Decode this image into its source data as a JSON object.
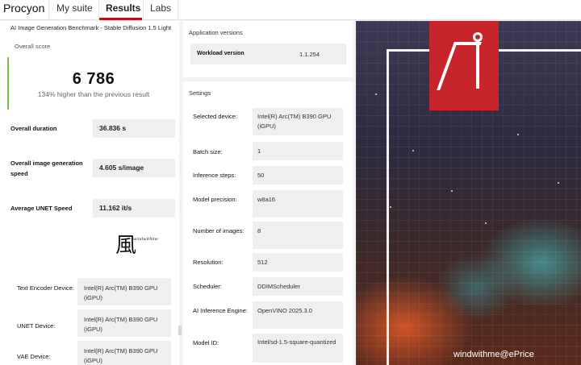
{
  "nav": {
    "brand": "Procyon",
    "tabs": [
      {
        "label": "My suite"
      },
      {
        "label": "Results"
      },
      {
        "label": "Labs"
      }
    ]
  },
  "benchmark": {
    "title": "AI Image Generation Benchmark - Stable Diffusion 1.5 Light",
    "overall_score_label": "Overall score",
    "overall_score": "6 786",
    "comparison": "134% higher than the previous result",
    "score_accent_color": "#7dc23f"
  },
  "metrics": [
    {
      "label": "Overall duration",
      "value": "36.836 s"
    },
    {
      "label": "Overall image generation speed",
      "value": "4.605 s/image"
    },
    {
      "label": "Average UNET Speed",
      "value": "11.162 it/s"
    }
  ],
  "logo": {
    "glyph": "風",
    "text": "windwithme"
  },
  "devices": [
    {
      "label": "Text Encoder Device:",
      "value": "Intel(R) Arc(TM) B390 GPU (iGPU)"
    },
    {
      "label": "UNET Device:",
      "value": "Intel(R) Arc(TM) B390 GPU (iGPU)"
    },
    {
      "label": "VAE Device:",
      "value": "Intel(R) Arc(TM) B390 GPU (iGPU)"
    }
  ],
  "application_versions": {
    "title": "Application versions",
    "workload_label": "Workload version",
    "workload_value": "1.1.254"
  },
  "settings": {
    "title": "Settings",
    "rows": [
      {
        "label": "Selected device:",
        "value": "Intel(R) Arc(TM) B390 GPU (iGPU)"
      },
      {
        "label": "Batch size:",
        "value": "1"
      },
      {
        "label": "Inference steps:",
        "value": "50"
      },
      {
        "label": "Model precision:",
        "value": "w8a16"
      },
      {
        "label": "Number of images:",
        "value": "8"
      },
      {
        "label": "Resolution:",
        "value": "512"
      },
      {
        "label": "Scheduler:",
        "value": "DDIMScheduler"
      },
      {
        "label": "AI Inference Engine:",
        "value": "OpenVINO 2025.3.0"
      },
      {
        "label": "Model ID:",
        "value": "Intel/sd-1.5-square-quantized"
      }
    ]
  },
  "image": {
    "watermark": "windwithme@ePrice",
    "brand_color": "#c8242c"
  }
}
